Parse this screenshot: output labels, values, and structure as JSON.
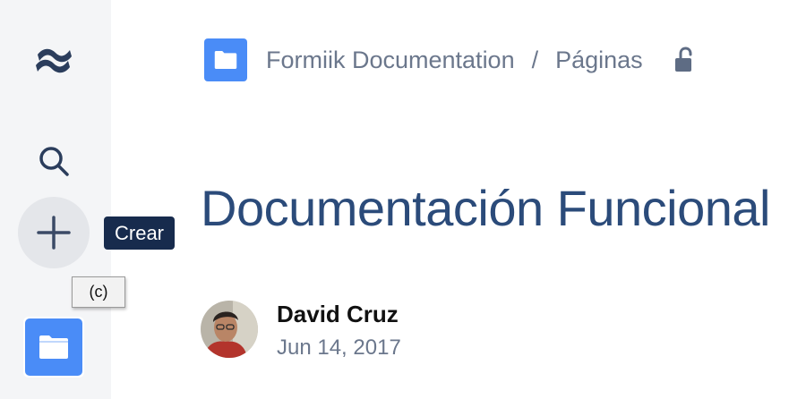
{
  "sidebar": {
    "logo_icon": "confluence-logo-icon",
    "search_icon": "search-icon",
    "create_icon": "plus-icon",
    "create_tooltip": "Crear",
    "create_shortcut": "(c)",
    "space_icon": "folder-icon"
  },
  "breadcrumb": {
    "space_icon": "folder-icon",
    "space_name": "Formiik Documentation",
    "separator": "/",
    "section": "Páginas",
    "restriction_icon": "unlock-icon"
  },
  "page": {
    "title": "Documentación Funcional",
    "author": "David Cruz",
    "date": "Jun 14, 2017"
  },
  "colors": {
    "sidebar_bg": "#f4f5f7",
    "accent": "#4a8cf7",
    "title": "#2b4b7a",
    "muted_text": "#6b778c",
    "tooltip_bg": "#172b4d"
  }
}
